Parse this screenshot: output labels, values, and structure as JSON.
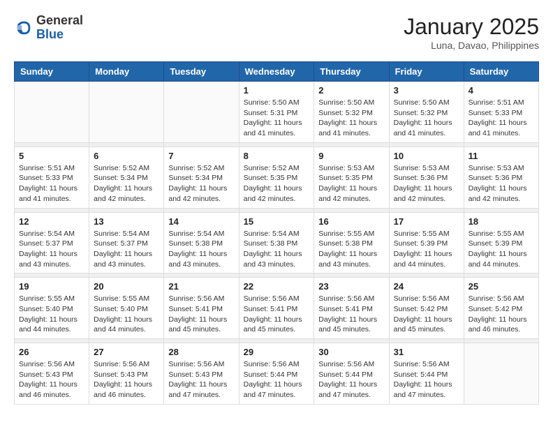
{
  "logo": {
    "general": "General",
    "blue": "Blue"
  },
  "header": {
    "month": "January 2025",
    "location": "Luna, Davao, Philippines"
  },
  "weekdays": [
    "Sunday",
    "Monday",
    "Tuesday",
    "Wednesday",
    "Thursday",
    "Friday",
    "Saturday"
  ],
  "weeks": [
    {
      "days": [
        {
          "num": "",
          "info": ""
        },
        {
          "num": "",
          "info": ""
        },
        {
          "num": "",
          "info": ""
        },
        {
          "num": "1",
          "info": "Sunrise: 5:50 AM\nSunset: 5:31 PM\nDaylight: 11 hours\nand 41 minutes."
        },
        {
          "num": "2",
          "info": "Sunrise: 5:50 AM\nSunset: 5:32 PM\nDaylight: 11 hours\nand 41 minutes."
        },
        {
          "num": "3",
          "info": "Sunrise: 5:50 AM\nSunset: 5:32 PM\nDaylight: 11 hours\nand 41 minutes."
        },
        {
          "num": "4",
          "info": "Sunrise: 5:51 AM\nSunset: 5:33 PM\nDaylight: 11 hours\nand 41 minutes."
        }
      ]
    },
    {
      "days": [
        {
          "num": "5",
          "info": "Sunrise: 5:51 AM\nSunset: 5:33 PM\nDaylight: 11 hours\nand 41 minutes."
        },
        {
          "num": "6",
          "info": "Sunrise: 5:52 AM\nSunset: 5:34 PM\nDaylight: 11 hours\nand 42 minutes."
        },
        {
          "num": "7",
          "info": "Sunrise: 5:52 AM\nSunset: 5:34 PM\nDaylight: 11 hours\nand 42 minutes."
        },
        {
          "num": "8",
          "info": "Sunrise: 5:52 AM\nSunset: 5:35 PM\nDaylight: 11 hours\nand 42 minutes."
        },
        {
          "num": "9",
          "info": "Sunrise: 5:53 AM\nSunset: 5:35 PM\nDaylight: 11 hours\nand 42 minutes."
        },
        {
          "num": "10",
          "info": "Sunrise: 5:53 AM\nSunset: 5:36 PM\nDaylight: 11 hours\nand 42 minutes."
        },
        {
          "num": "11",
          "info": "Sunrise: 5:53 AM\nSunset: 5:36 PM\nDaylight: 11 hours\nand 42 minutes."
        }
      ]
    },
    {
      "days": [
        {
          "num": "12",
          "info": "Sunrise: 5:54 AM\nSunset: 5:37 PM\nDaylight: 11 hours\nand 43 minutes."
        },
        {
          "num": "13",
          "info": "Sunrise: 5:54 AM\nSunset: 5:37 PM\nDaylight: 11 hours\nand 43 minutes."
        },
        {
          "num": "14",
          "info": "Sunrise: 5:54 AM\nSunset: 5:38 PM\nDaylight: 11 hours\nand 43 minutes."
        },
        {
          "num": "15",
          "info": "Sunrise: 5:54 AM\nSunset: 5:38 PM\nDaylight: 11 hours\nand 43 minutes."
        },
        {
          "num": "16",
          "info": "Sunrise: 5:55 AM\nSunset: 5:38 PM\nDaylight: 11 hours\nand 43 minutes."
        },
        {
          "num": "17",
          "info": "Sunrise: 5:55 AM\nSunset: 5:39 PM\nDaylight: 11 hours\nand 44 minutes."
        },
        {
          "num": "18",
          "info": "Sunrise: 5:55 AM\nSunset: 5:39 PM\nDaylight: 11 hours\nand 44 minutes."
        }
      ]
    },
    {
      "days": [
        {
          "num": "19",
          "info": "Sunrise: 5:55 AM\nSunset: 5:40 PM\nDaylight: 11 hours\nand 44 minutes."
        },
        {
          "num": "20",
          "info": "Sunrise: 5:55 AM\nSunset: 5:40 PM\nDaylight: 11 hours\nand 44 minutes."
        },
        {
          "num": "21",
          "info": "Sunrise: 5:56 AM\nSunset: 5:41 PM\nDaylight: 11 hours\nand 45 minutes."
        },
        {
          "num": "22",
          "info": "Sunrise: 5:56 AM\nSunset: 5:41 PM\nDaylight: 11 hours\nand 45 minutes."
        },
        {
          "num": "23",
          "info": "Sunrise: 5:56 AM\nSunset: 5:41 PM\nDaylight: 11 hours\nand 45 minutes."
        },
        {
          "num": "24",
          "info": "Sunrise: 5:56 AM\nSunset: 5:42 PM\nDaylight: 11 hours\nand 45 minutes."
        },
        {
          "num": "25",
          "info": "Sunrise: 5:56 AM\nSunset: 5:42 PM\nDaylight: 11 hours\nand 46 minutes."
        }
      ]
    },
    {
      "days": [
        {
          "num": "26",
          "info": "Sunrise: 5:56 AM\nSunset: 5:43 PM\nDaylight: 11 hours\nand 46 minutes."
        },
        {
          "num": "27",
          "info": "Sunrise: 5:56 AM\nSunset: 5:43 PM\nDaylight: 11 hours\nand 46 minutes."
        },
        {
          "num": "28",
          "info": "Sunrise: 5:56 AM\nSunset: 5:43 PM\nDaylight: 11 hours\nand 47 minutes."
        },
        {
          "num": "29",
          "info": "Sunrise: 5:56 AM\nSunset: 5:44 PM\nDaylight: 11 hours\nand 47 minutes."
        },
        {
          "num": "30",
          "info": "Sunrise: 5:56 AM\nSunset: 5:44 PM\nDaylight: 11 hours\nand 47 minutes."
        },
        {
          "num": "31",
          "info": "Sunrise: 5:56 AM\nSunset: 5:44 PM\nDaylight: 11 hours\nand 47 minutes."
        },
        {
          "num": "",
          "info": ""
        }
      ]
    }
  ]
}
